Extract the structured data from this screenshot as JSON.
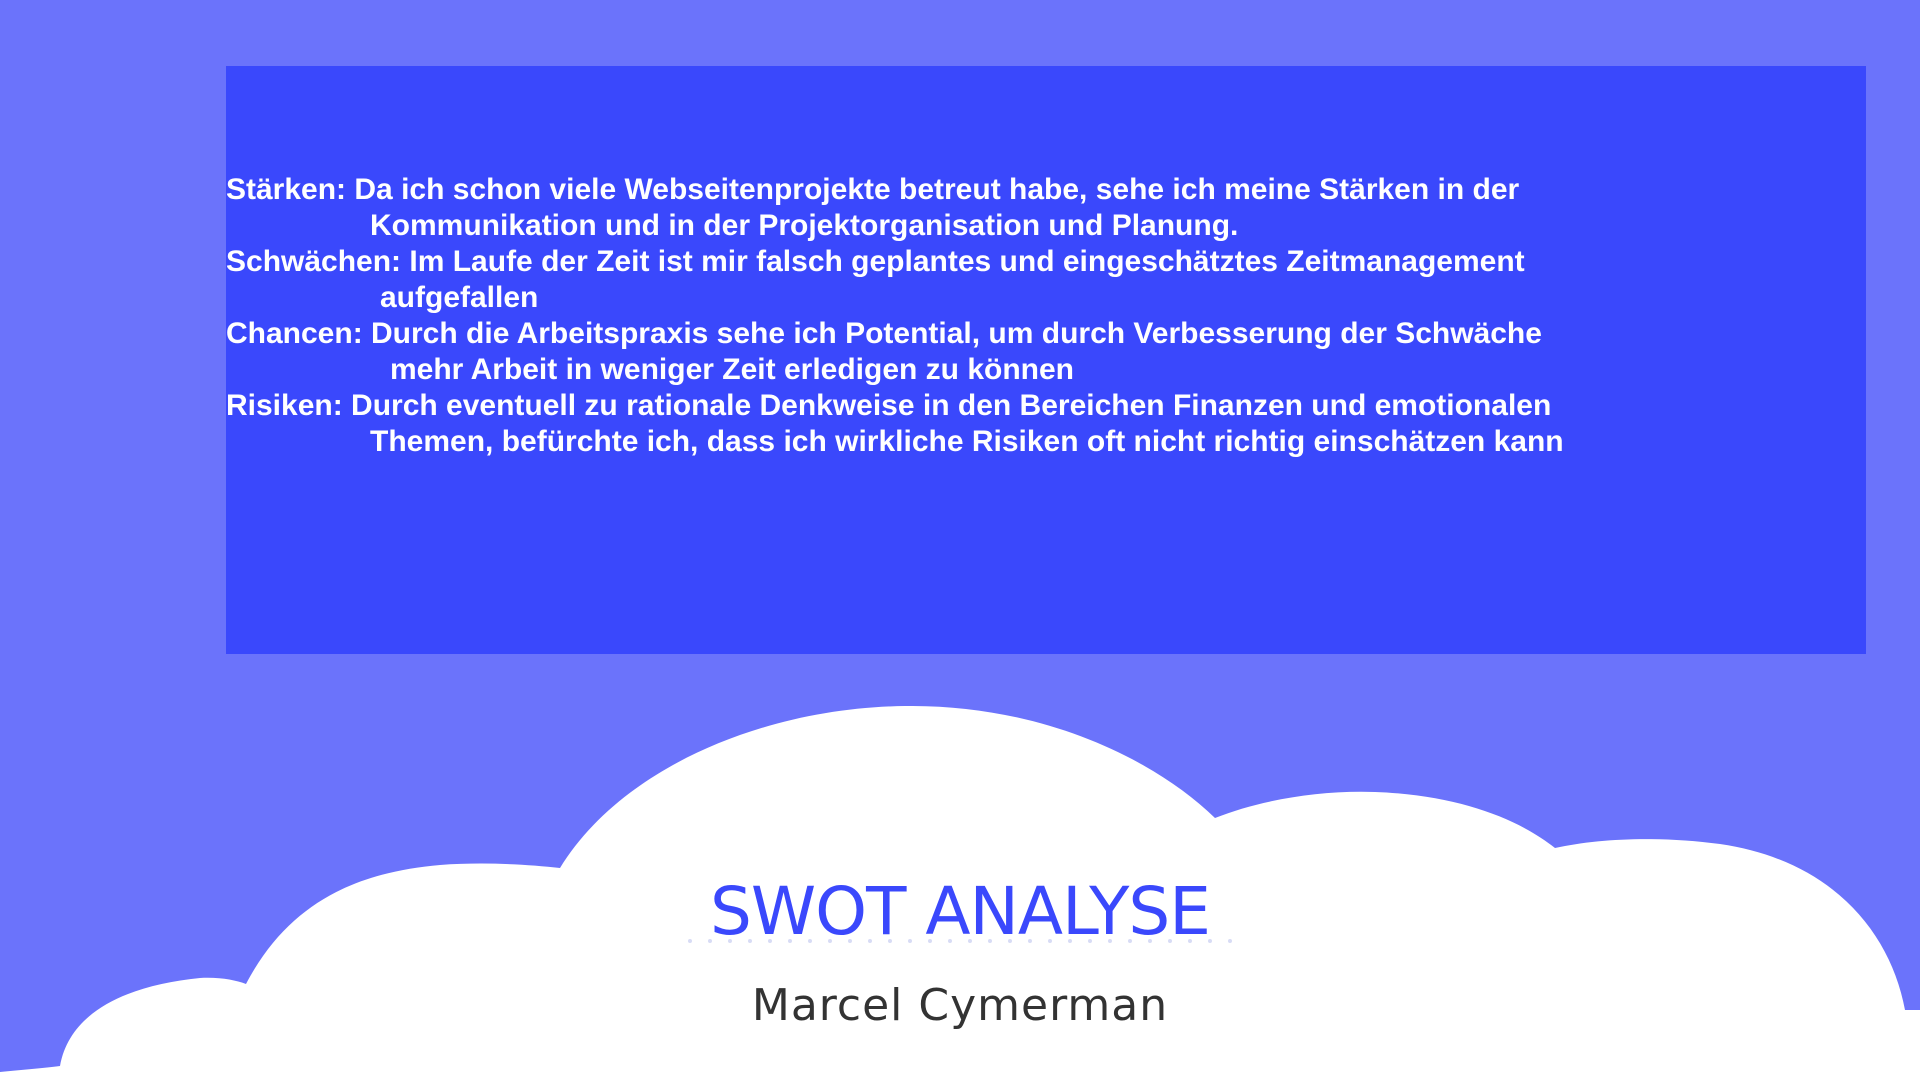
{
  "slide": {
    "background_color": "#6b73fb",
    "box_color": "#3a48fc",
    "cloud_color": "#ffffff",
    "swot": [
      {
        "line1": "Stärken: Da ich schon viele Webseitenprojekte betreut habe, sehe ich meine Stärken in der",
        "line2": "Kommunikation und in der Projektorganisation und Planung."
      },
      {
        "line1": "Schwächen: Im Laufe der Zeit ist mir falsch geplantes und eingeschätztes Zeitmanagement",
        "line2": "aufgefallen"
      },
      {
        "line1": "Chancen: Durch die Arbeitspraxis sehe ich Potential, um durch Verbesserung der Schwäche",
        "line2": "mehr Arbeit in weniger Zeit erledigen zu können"
      },
      {
        "line1": "Risiken: Durch eventuell zu rationale Denkweise in den Bereichen Finanzen und emotionalen",
        "line2": "Themen, befürchte ich, dass ich wirkliche Risiken oft nicht richtig einschätzen kann"
      }
    ],
    "title": "SWOT ANALYSE",
    "author": "Marcel Cymerman"
  }
}
